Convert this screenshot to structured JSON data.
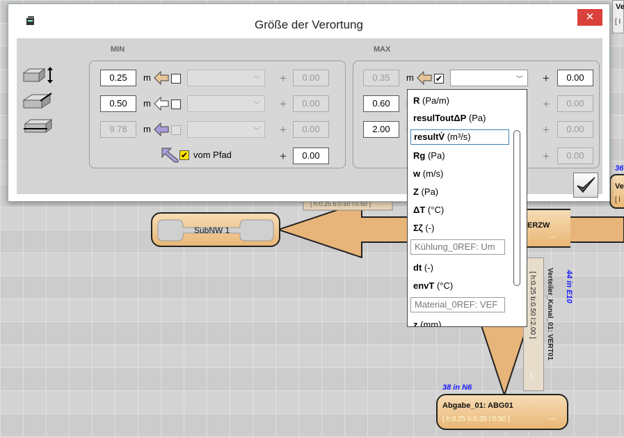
{
  "dialog": {
    "title": "Größe der Verortung",
    "close_glyph": "✕",
    "min_header": "MIN",
    "max_header": "MAX",
    "min_rows": [
      {
        "value": "0.25",
        "unit": "m",
        "checked": false,
        "offset": "0.00"
      },
      {
        "value": "0.50",
        "unit": "m",
        "checked": false,
        "offset": "0.00"
      },
      {
        "value": "9.78",
        "unit": "m",
        "checked": false,
        "offset": "0.00"
      }
    ],
    "min_path": {
      "label": "vom Pfad",
      "checked": true,
      "offset": "0.00"
    },
    "max_rows": [
      {
        "value": "0.35",
        "unit": "m",
        "checked": true,
        "offset": "0.00"
      },
      {
        "value": "0.60",
        "unit": "m",
        "checked": false,
        "offset": "0.00"
      },
      {
        "value": "2.00",
        "unit": "m",
        "checked": false,
        "offset": "0.00"
      }
    ],
    "max_path_offset": "0.00",
    "plus": "+",
    "checkmark": "✔"
  },
  "dropdown": {
    "items": [
      {
        "name": "R",
        "unit": "(Pa/m)"
      },
      {
        "name": "resulToutΔP",
        "unit": "(Pa)"
      },
      {
        "name": "resultV̇",
        "unit": "(m³/s)",
        "selected": true
      },
      {
        "name": "Rg",
        "unit": "(Pa)"
      },
      {
        "name": "w",
        "unit": "(m/s)"
      },
      {
        "name": "Z",
        "unit": "(Pa)"
      },
      {
        "name": "ΔT",
        "unit": "(°C)"
      },
      {
        "name": "Σζ",
        "unit": "(-)"
      },
      {
        "ref": "Kühlung_0REF: Um"
      },
      {
        "name": "dt",
        "unit": "(-)"
      },
      {
        "name": "envT",
        "unit": "(°C)"
      },
      {
        "ref": "Material_0REF: VEF"
      },
      {
        "name": "z",
        "unit": "(mm)"
      }
    ]
  },
  "canvas": {
    "subnw_label": "SubNW 1",
    "erzw_label": "ERZW",
    "abgabe_tag": "38 in N6",
    "abgabe_label": "Abgabe_01: ABG01",
    "abgabe_dims": "[ h:0.25 b:0.35 l:0.50 ]",
    "dashes": "---",
    "verteiler_tag": "44 in E10",
    "verteiler_label": "Verteiler_Kanal_01: VERT01",
    "verteiler_dims": "[ h:0.25 b:0.50 l:2.00 ]",
    "top_dims": "[ h:0.25 b:0.50 l:0.50 ]",
    "right_tag": "36",
    "right_label_1": "Ve",
    "right_label_2": "[ l",
    "top_right_1": "Ve",
    "top_right_2": "[ I"
  },
  "colors": {
    "node_fill": "#e9b776",
    "accent_blue": "#1a1aff",
    "close_red": "#d9413a",
    "checkbox_yellow": "#ffe600"
  }
}
